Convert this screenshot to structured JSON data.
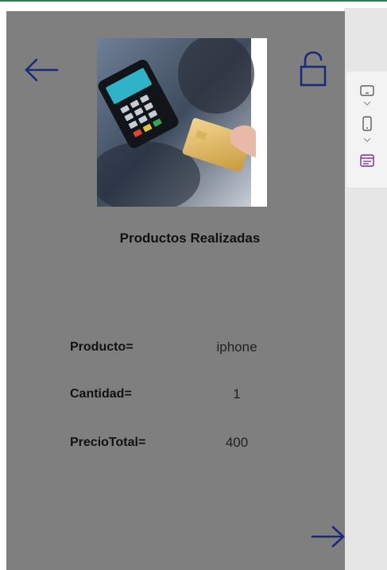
{
  "screen": {
    "title": "Productos Realizadas",
    "rows": [
      {
        "label": "Producto=",
        "value": "iphone"
      },
      {
        "label": "Cantidad=",
        "value": "1"
      },
      {
        "label": "PrecioTotal=",
        "value": "400"
      }
    ]
  },
  "icons": {
    "back": "back-arrow-icon",
    "lock": "unlocked-padlock-icon",
    "next": "forward-arrow-icon",
    "photo": "card-payment-photo"
  },
  "view_toolbar": {
    "items": [
      "tablet-layout-icon",
      "phone-layout-icon",
      "screen-layout-icon"
    ]
  },
  "colors": {
    "screen_background": "#7f7f7f",
    "icon_navy": "#1b2a78",
    "accent_purple": "#7a2d8c",
    "top_border": "#2e7d4f"
  }
}
